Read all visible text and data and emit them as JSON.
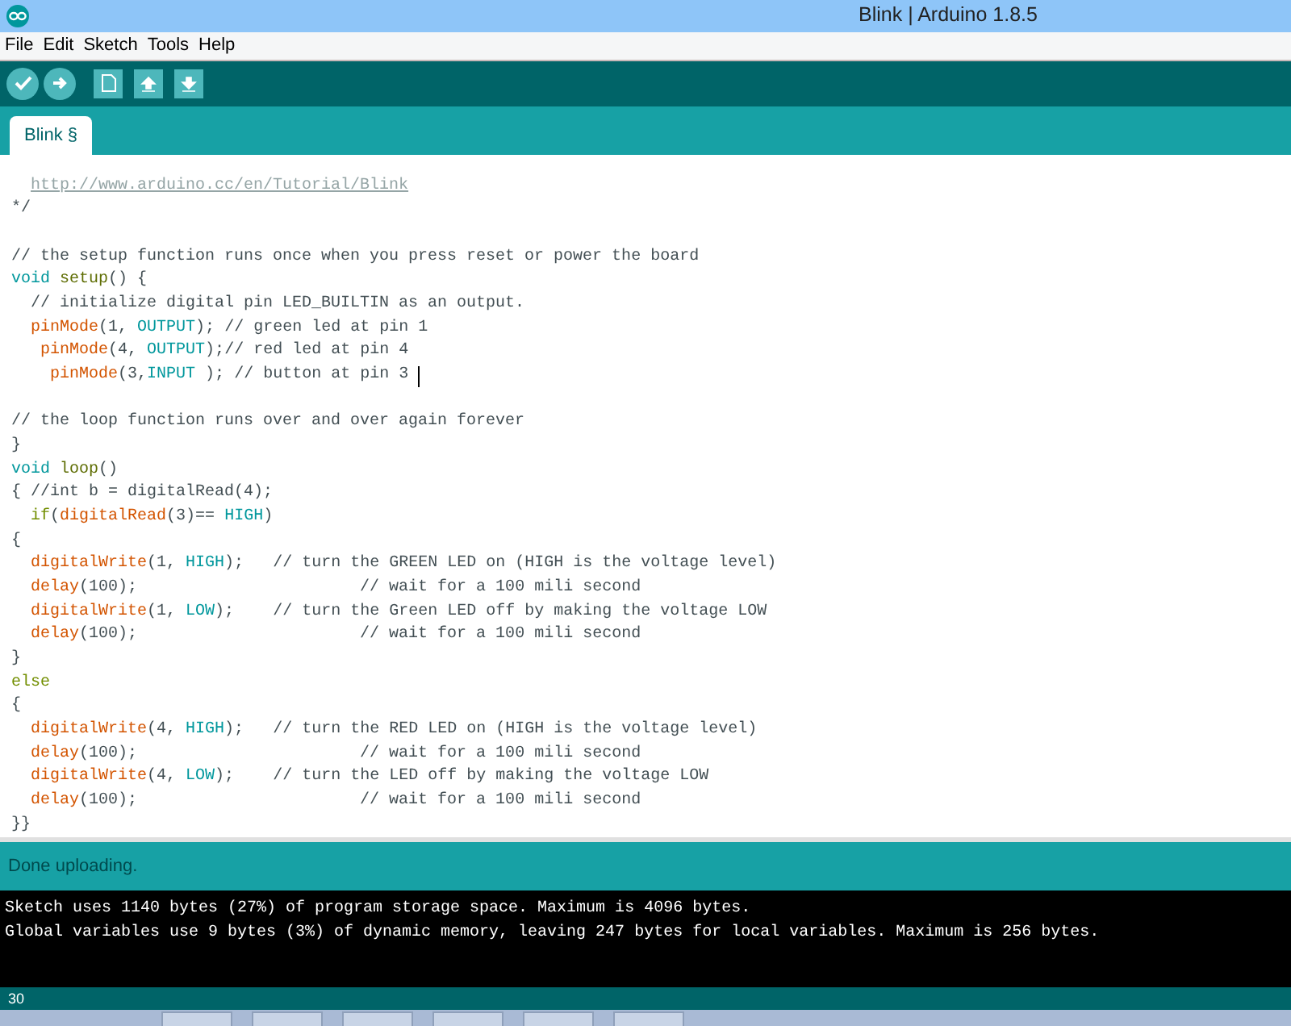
{
  "window": {
    "title": "Blink | Arduino 1.8.5"
  },
  "menu": [
    "File",
    "Edit",
    "Sketch",
    "Tools",
    "Help"
  ],
  "toolbar": [
    {
      "kind": "verify"
    },
    {
      "kind": "upload"
    },
    {
      "kind": "new"
    },
    {
      "kind": "open"
    },
    {
      "kind": "save"
    }
  ],
  "tabs": [
    {
      "label": "Blink §",
      "selected": true
    }
  ],
  "code": [
    {
      "tokens": [
        {
          "kind": "link",
          "text": "  http://www.arduino.cc/en/Tutorial/Blink"
        }
      ]
    },
    {
      "tokens": [
        {
          "kind": "comment",
          "text": "*/"
        }
      ]
    },
    {
      "kind": "blank"
    },
    {
      "tokens": [
        {
          "kind": "comment",
          "text": "// the setup function runs once when you press reset or power the board"
        }
      ]
    },
    {
      "tokens": [
        {
          "kind": "type",
          "text": "void"
        },
        {
          "kind": "function",
          "text": " setup"
        },
        {
          "kind": "plain",
          "text": "() {"
        }
      ]
    },
    {
      "tokens": [
        {
          "kind": "comment",
          "text": "  // initialize digital pin LED_BUILTIN as an output."
        }
      ]
    },
    {
      "tokens": [
        {
          "kind": "builtin",
          "text": "  pinMode"
        },
        {
          "kind": "plain",
          "text": "(1, "
        },
        {
          "kind": "type",
          "text": "OUTPUT"
        },
        {
          "kind": "plain",
          "text": "); "
        },
        {
          "kind": "comment",
          "text": "// green led at pin 1"
        }
      ]
    },
    {
      "tokens": [
        {
          "kind": "builtin",
          "text": "   pinMode"
        },
        {
          "kind": "plain",
          "text": "(4, "
        },
        {
          "kind": "type",
          "text": "OUTPUT"
        },
        {
          "kind": "plain",
          "text": ");"
        },
        {
          "kind": "comment",
          "text": "// red led at pin 4"
        }
      ]
    },
    {
      "cursor": true,
      "tokens": [
        {
          "kind": "builtin",
          "text": "    pinMode"
        },
        {
          "kind": "plain",
          "text": "(3,"
        },
        {
          "kind": "type",
          "text": "INPUT"
        },
        {
          "kind": "plain",
          "text": " ); "
        },
        {
          "kind": "comment",
          "text": "// button at pin 3 "
        }
      ]
    },
    {
      "kind": "blank"
    },
    {
      "tokens": [
        {
          "kind": "comment",
          "text": "// the loop function runs over and over again forever"
        }
      ]
    },
    {
      "tokens": [
        {
          "kind": "plain",
          "text": "}"
        }
      ]
    },
    {
      "tokens": [
        {
          "kind": "type",
          "text": "void"
        },
        {
          "kind": "function",
          "text": " loop"
        },
        {
          "kind": "plain",
          "text": "()"
        }
      ]
    },
    {
      "tokens": [
        {
          "kind": "plain",
          "text": "{ "
        },
        {
          "kind": "comment",
          "text": "//int b = digitalRead(4);"
        }
      ]
    },
    {
      "tokens": [
        {
          "kind": "control",
          "text": "  if"
        },
        {
          "kind": "plain",
          "text": "("
        },
        {
          "kind": "builtin",
          "text": "digitalRead"
        },
        {
          "kind": "plain",
          "text": "(3)== "
        },
        {
          "kind": "type",
          "text": "HIGH"
        },
        {
          "kind": "plain",
          "text": ")"
        }
      ]
    },
    {
      "tokens": [
        {
          "kind": "plain",
          "text": "{"
        }
      ]
    },
    {
      "tokens": [
        {
          "kind": "builtin",
          "text": "  digitalWrite"
        },
        {
          "kind": "plain",
          "text": "(1, "
        },
        {
          "kind": "type",
          "text": "HIGH"
        },
        {
          "kind": "plain",
          "text": ");   "
        },
        {
          "kind": "comment",
          "text": "// turn the GREEN LED on (HIGH is the voltage level)"
        }
      ]
    },
    {
      "tokens": [
        {
          "kind": "builtin",
          "text": "  delay"
        },
        {
          "kind": "plain",
          "text": "(100);                       "
        },
        {
          "kind": "comment",
          "text": "// wait for a 100 mili second"
        }
      ]
    },
    {
      "tokens": [
        {
          "kind": "builtin",
          "text": "  digitalWrite"
        },
        {
          "kind": "plain",
          "text": "(1, "
        },
        {
          "kind": "type",
          "text": "LOW"
        },
        {
          "kind": "plain",
          "text": ");    "
        },
        {
          "kind": "comment",
          "text": "// turn the Green LED off by making the voltage LOW"
        }
      ]
    },
    {
      "tokens": [
        {
          "kind": "builtin",
          "text": "  delay"
        },
        {
          "kind": "plain",
          "text": "(100);                       "
        },
        {
          "kind": "comment",
          "text": "// wait for a 100 mili second"
        }
      ]
    },
    {
      "tokens": [
        {
          "kind": "plain",
          "text": "}"
        }
      ]
    },
    {
      "tokens": [
        {
          "kind": "control",
          "text": "else"
        }
      ]
    },
    {
      "tokens": [
        {
          "kind": "plain",
          "text": "{"
        }
      ]
    },
    {
      "tokens": [
        {
          "kind": "builtin",
          "text": "  digitalWrite"
        },
        {
          "kind": "plain",
          "text": "(4, "
        },
        {
          "kind": "type",
          "text": "HIGH"
        },
        {
          "kind": "plain",
          "text": ");   "
        },
        {
          "kind": "comment",
          "text": "// turn the RED LED on (HIGH is the voltage level)"
        }
      ]
    },
    {
      "tokens": [
        {
          "kind": "builtin",
          "text": "  delay"
        },
        {
          "kind": "plain",
          "text": "(100);                       "
        },
        {
          "kind": "comment",
          "text": "// wait for a 100 mili second"
        }
      ]
    },
    {
      "tokens": [
        {
          "kind": "builtin",
          "text": "  digitalWrite"
        },
        {
          "kind": "plain",
          "text": "(4, "
        },
        {
          "kind": "type",
          "text": "LOW"
        },
        {
          "kind": "plain",
          "text": ");    "
        },
        {
          "kind": "comment",
          "text": "// turn the LED off by making the voltage LOW"
        }
      ]
    },
    {
      "tokens": [
        {
          "kind": "builtin",
          "text": "  delay"
        },
        {
          "kind": "plain",
          "text": "(100);                       "
        },
        {
          "kind": "comment",
          "text": "// wait for a 100 mili second"
        }
      ]
    },
    {
      "tokens": [
        {
          "kind": "plain",
          "text": "}}"
        }
      ]
    }
  ],
  "status": "Done uploading.",
  "console": [
    "Sketch uses 1140 bytes (27%) of program storage space. Maximum is 4096 bytes.",
    "Global variables use 9 bytes (3%) of dynamic memory, leaving 247 bytes for local variables. Maximum is 256 bytes."
  ],
  "line_number": "30"
}
